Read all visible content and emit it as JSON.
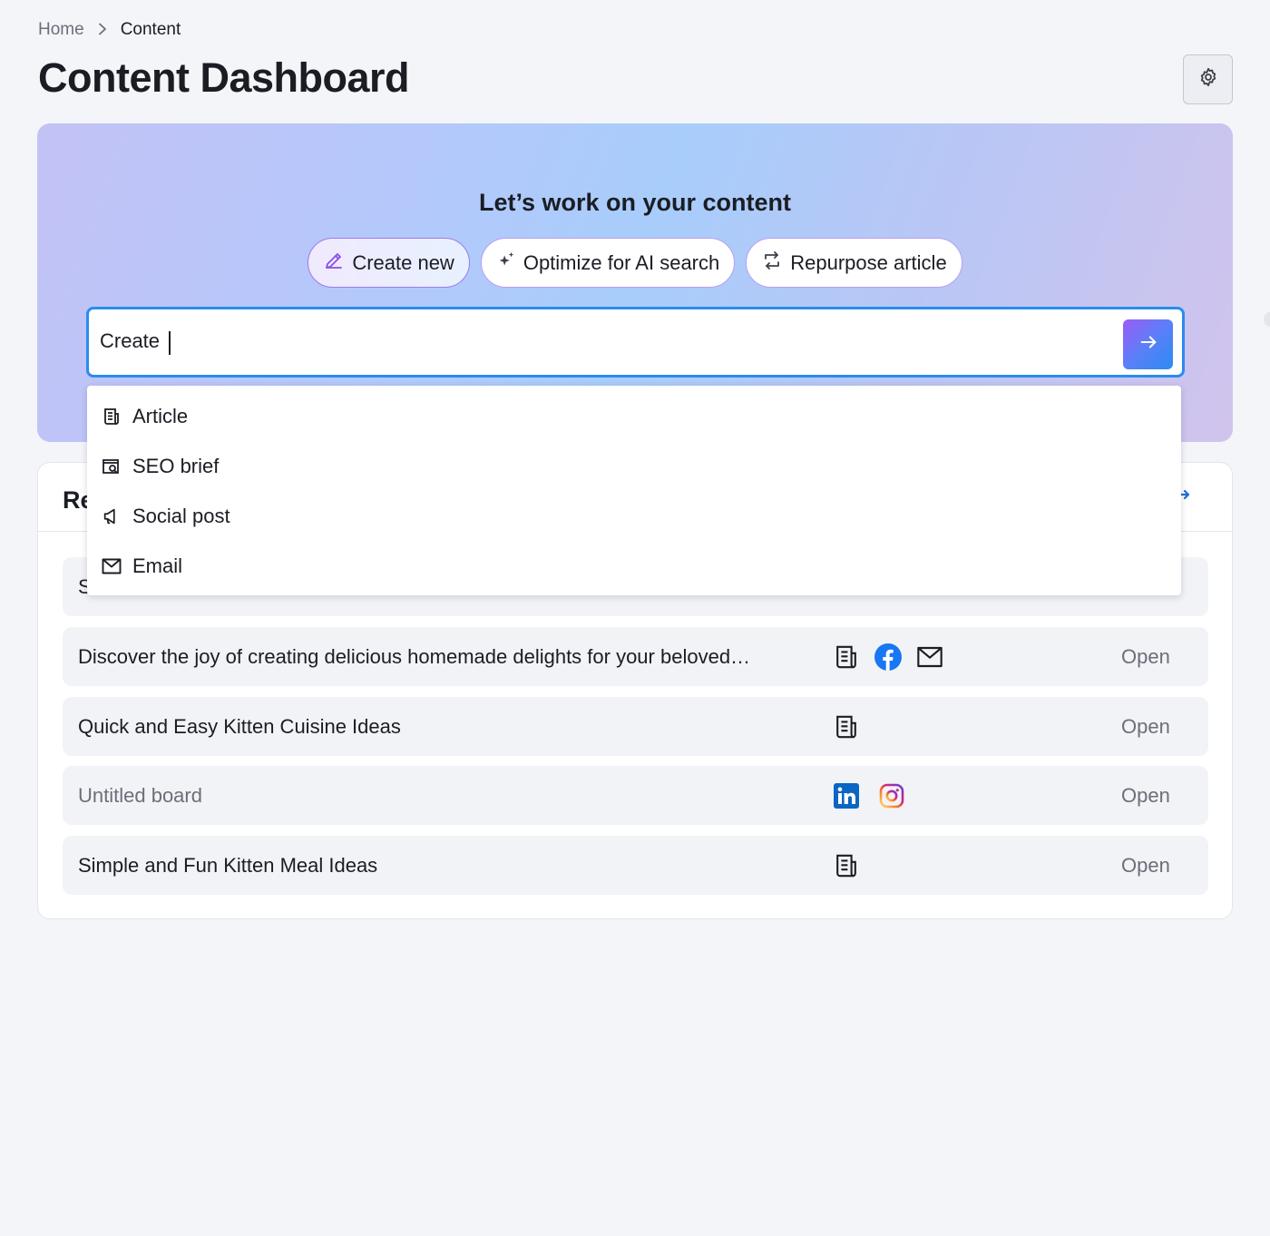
{
  "breadcrumb": {
    "home": "Home",
    "current": "Content"
  },
  "page": {
    "title": "Content Dashboard"
  },
  "hero": {
    "title": "Let’s work on your content",
    "tabs": [
      {
        "label": "Create new",
        "icon": "pencil-icon",
        "active": true
      },
      {
        "label": "Optimize for AI search",
        "icon": "sparkle-icon",
        "active": false
      },
      {
        "label": "Repurpose article",
        "icon": "repurpose-icon",
        "active": false
      }
    ],
    "search": {
      "value": "Create "
    }
  },
  "dropdown": {
    "items": [
      {
        "label": "Article",
        "icon": "article-icon"
      },
      {
        "label": "SEO brief",
        "icon": "seo-brief-icon"
      },
      {
        "label": "Social post",
        "icon": "megaphone-icon"
      },
      {
        "label": "Email",
        "icon": "email-icon"
      }
    ]
  },
  "recent": {
    "title_visible": "Re",
    "rows": [
      {
        "title": "Discover the joy of creating delicious homemade delights for your beloved…",
        "channels": [
          "article",
          "facebook",
          "email"
        ],
        "open": "Open",
        "muted": false
      },
      {
        "title": "Quick and Easy Kitten Cuisine Ideas",
        "channels": [
          "article"
        ],
        "open": "Open",
        "muted": false
      },
      {
        "title": "Untitled board",
        "channels": [
          "linkedin",
          "instagram"
        ],
        "open": "Open",
        "muted": true
      },
      {
        "title": "Simple and Fun Kitten Meal Ideas",
        "channels": [
          "article"
        ],
        "open": "Open",
        "muted": false
      }
    ]
  },
  "colors": {
    "accent": "#2a8cf0",
    "tab_border": "#b89ff5",
    "link": "#1d6fd8"
  }
}
